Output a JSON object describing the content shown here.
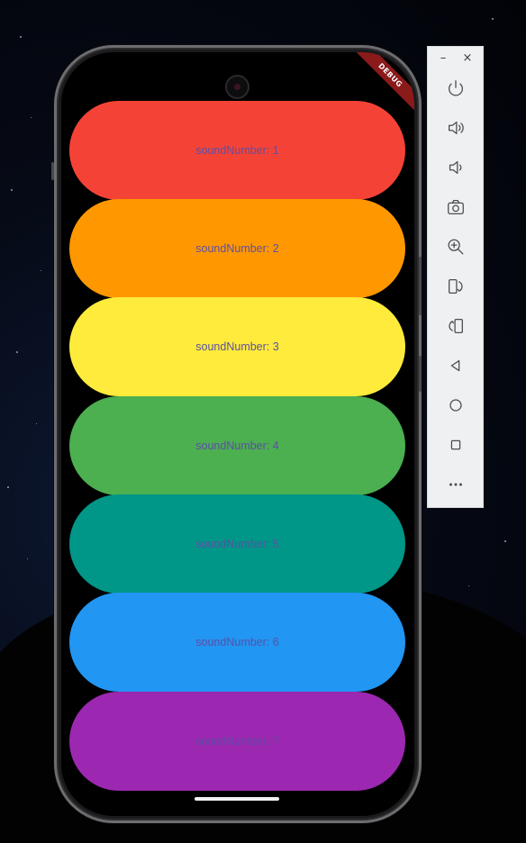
{
  "app": {
    "debug_banner": "DEBUG"
  },
  "buttons": [
    {
      "label": "soundNumber: 1",
      "color": "#f44336"
    },
    {
      "label": "soundNumber: 2",
      "color": "#ff9800"
    },
    {
      "label": "soundNumber: 3",
      "color": "#ffeb3b"
    },
    {
      "label": "soundNumber: 4",
      "color": "#4caf50"
    },
    {
      "label": "soundNumber: 5",
      "color": "#009688"
    },
    {
      "label": "soundNumber: 6",
      "color": "#2196f3"
    },
    {
      "label": "soundNumber: 7",
      "color": "#9c27b0"
    }
  ],
  "label_color": "#5c4fa6",
  "toolbar": {
    "minimize_label": "–",
    "close_label": "×",
    "tools": [
      {
        "icon": "power-icon"
      },
      {
        "icon": "volume-up-icon"
      },
      {
        "icon": "volume-down-icon"
      },
      {
        "icon": "camera-icon"
      },
      {
        "icon": "zoom-in-icon"
      },
      {
        "icon": "rotate-left-icon"
      },
      {
        "icon": "rotate-right-icon"
      },
      {
        "icon": "back-icon"
      },
      {
        "icon": "home-icon"
      },
      {
        "icon": "overview-icon"
      },
      {
        "icon": "more-icon"
      }
    ]
  }
}
